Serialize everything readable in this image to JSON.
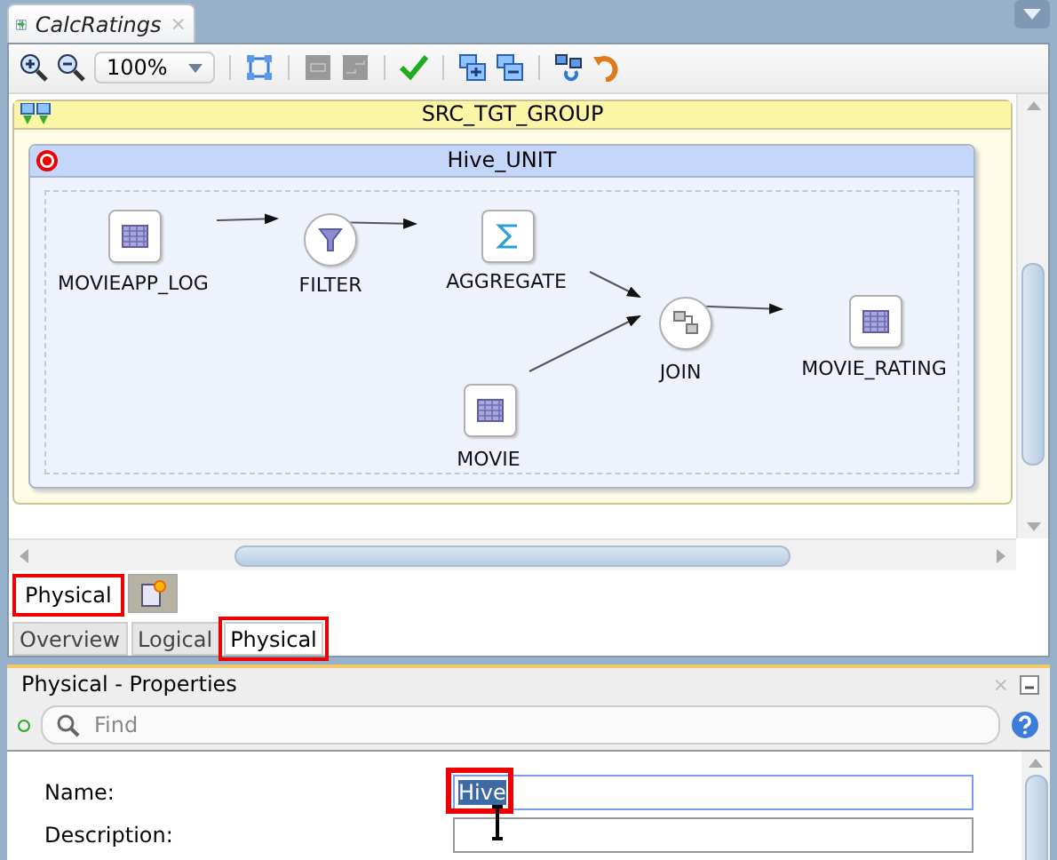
{
  "document_tab": {
    "title": "CalcRatings",
    "close": "×"
  },
  "toolbar": {
    "zoom": "100%"
  },
  "diagram": {
    "group": {
      "title": "SRC_TGT_GROUP"
    },
    "unit": {
      "title": "Hive_UNIT"
    },
    "nodes": [
      {
        "name": "MOVIEAPP_LOG",
        "kind": "table"
      },
      {
        "name": "FILTER",
        "kind": "filter"
      },
      {
        "name": "AGGREGATE",
        "kind": "aggregate"
      },
      {
        "name": "MOVIE",
        "kind": "table"
      },
      {
        "name": "JOIN",
        "kind": "join"
      },
      {
        "name": "MOVIE_RATING",
        "kind": "table"
      }
    ]
  },
  "editor_tabs": [
    {
      "label": "Physical",
      "kind": "text",
      "selected": true,
      "highlighted": true
    },
    {
      "kind": "icon",
      "selected": false,
      "highlighted": false
    }
  ],
  "view_tabs": [
    {
      "label": "Overview",
      "selected": false,
      "highlighted": false
    },
    {
      "label": "Logical",
      "selected": false,
      "highlighted": false
    },
    {
      "label": "Physical",
      "selected": true,
      "highlighted": true
    }
  ],
  "properties": {
    "title": "Physical - Properties",
    "close": "×",
    "search": {
      "placeholder": "Find"
    },
    "fields": [
      {
        "label": "Name:",
        "value": "Hive",
        "selected": true,
        "highlighted": true
      },
      {
        "label": "Description:",
        "selected": false,
        "highlighted": false
      }
    ]
  }
}
